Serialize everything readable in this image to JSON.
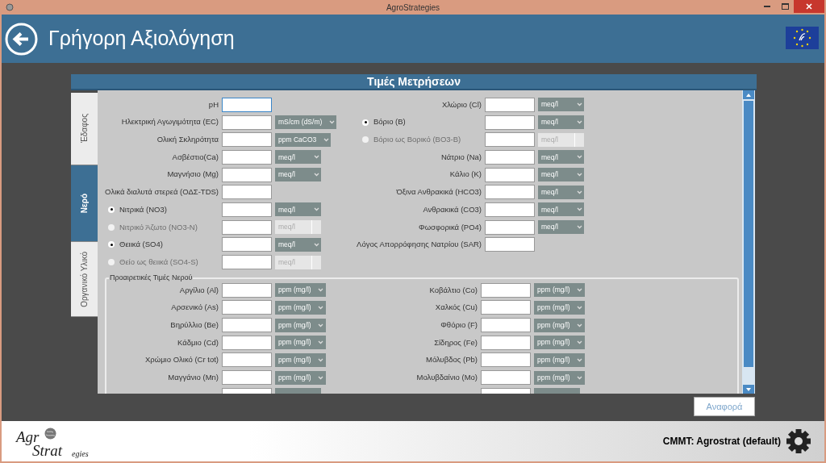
{
  "window": {
    "title": "AgroStrategies"
  },
  "header": {
    "title": "Γρήγορη Αξιολόγηση"
  },
  "panel": {
    "title": "Τιμές Μετρήσεων"
  },
  "tabs": [
    {
      "label": "Έδαφος",
      "selected": false
    },
    {
      "label": "Νερό",
      "selected": true
    },
    {
      "label": "Οργανικό Υλικό",
      "selected": false
    }
  ],
  "left_fields": [
    {
      "kind": "field",
      "label": "pH",
      "focused": true
    },
    {
      "kind": "field",
      "label": "Ηλεκτρική Αγωγιμότητα (EC)",
      "focused": false,
      "unit": "mS/cm (dS/m)"
    },
    {
      "kind": "field",
      "label": "Ολική Σκληρότητα",
      "focused": false,
      "unit": "ppm CaCO3"
    },
    {
      "kind": "field",
      "label": "Ασβέστιο(Ca)",
      "focused": false,
      "unit": "meq/l"
    },
    {
      "kind": "field",
      "label": "Μαγνήσιο (Mg)",
      "focused": false,
      "unit": "meq/l"
    },
    {
      "kind": "field",
      "label": "Ολικά διαλυτά στερεά (ΟΔΣ-TDS)",
      "focused": false
    },
    {
      "kind": "radio",
      "label": "Νιτρικά (NO3)",
      "selected": true,
      "unit": "meq/l"
    },
    {
      "kind": "radio",
      "label": "Νιτρικό Άζωτο (NO3-N)",
      "selected": false,
      "unit": "meq/l"
    },
    {
      "kind": "radio",
      "label": "Θειικά (SO4)",
      "selected": true,
      "unit": "meq/l"
    },
    {
      "kind": "radio",
      "label": "Θείο ως θειικά (SO4-S)",
      "selected": false,
      "unit": "meq/l"
    }
  ],
  "right_fields": [
    {
      "kind": "field",
      "label": "Χλώριο (Cl)",
      "focused": false,
      "unit": "meq/l"
    },
    {
      "kind": "radio",
      "label": "Βόριο (B)",
      "selected": true,
      "unit": "meq/l"
    },
    {
      "kind": "radio",
      "label": "Βόριο ως Βορικό (BO3-B)",
      "selected": false,
      "unit": "meq/l"
    },
    {
      "kind": "field",
      "label": "Νάτριο (Na)",
      "focused": false,
      "unit": "meq/l"
    },
    {
      "kind": "field",
      "label": "Κάλιο (K)",
      "focused": false,
      "unit": "meq/l"
    },
    {
      "kind": "field",
      "label": "Όξινα Ανθρακικά (HCO3)",
      "focused": false,
      "unit": "meq/l"
    },
    {
      "kind": "field",
      "label": "Ανθρακικά (CO3)",
      "focused": false,
      "unit": "meq/l"
    },
    {
      "kind": "field",
      "label": "Φωσφορικά (PO4)",
      "focused": false,
      "unit": "meq/l"
    },
    {
      "kind": "field",
      "label": "Λόγος Απορρόφησης Νατρίου (SAR)",
      "focused": false
    }
  ],
  "optional": {
    "title": "Προαιρετικές Τιμές Νερού",
    "left": [
      {
        "kind": "field",
        "label": "Αργίλιο (Al)",
        "focused": false,
        "unit": "ppm (mg/l)"
      },
      {
        "kind": "field",
        "label": "Αρσενικό (As)",
        "focused": false,
        "unit": "ppm (mg/l)"
      },
      {
        "kind": "field",
        "label": "Βηρύλλιο (Be)",
        "focused": false,
        "unit": "ppm (mg/l)"
      },
      {
        "kind": "field",
        "label": "Κάδμιο (Cd)",
        "focused": false,
        "unit": "ppm (mg/l)"
      },
      {
        "kind": "field",
        "label": "Χρώμιο Ολικό (Cr tot)",
        "focused": false,
        "unit": "ppm (mg/l)"
      },
      {
        "kind": "field",
        "label": "Μαγγάνιο (Mn)",
        "focused": false,
        "unit": "ppm (mg/l)"
      },
      {
        "kind": "partial"
      }
    ],
    "right": [
      {
        "kind": "field",
        "label": "Κοβάλτιο (Co)",
        "focused": false,
        "unit": "ppm (mg/l)"
      },
      {
        "kind": "field",
        "label": "Χαλκός (Cu)",
        "focused": false,
        "unit": "ppm (mg/l)"
      },
      {
        "kind": "field",
        "label": "Φθόριο (F)",
        "focused": false,
        "unit": "ppm (mg/l)"
      },
      {
        "kind": "field",
        "label": "Σίδηρος (Fe)",
        "focused": false,
        "unit": "ppm (mg/l)"
      },
      {
        "kind": "field",
        "label": "Μόλυβδος (Pb)",
        "focused": false,
        "unit": "ppm (mg/l)"
      },
      {
        "kind": "field",
        "label": "Μολυβδαίνιο (Mo)",
        "focused": false,
        "unit": "ppm (mg/l)"
      },
      {
        "kind": "partial"
      }
    ]
  },
  "report_button": "Αναφορά",
  "footer": {
    "logo": {
      "line_1": "Agr",
      "line_2": "Strat",
      "line_3": "egies"
    },
    "profile": "CMMT: Agrostrat (default)"
  }
}
